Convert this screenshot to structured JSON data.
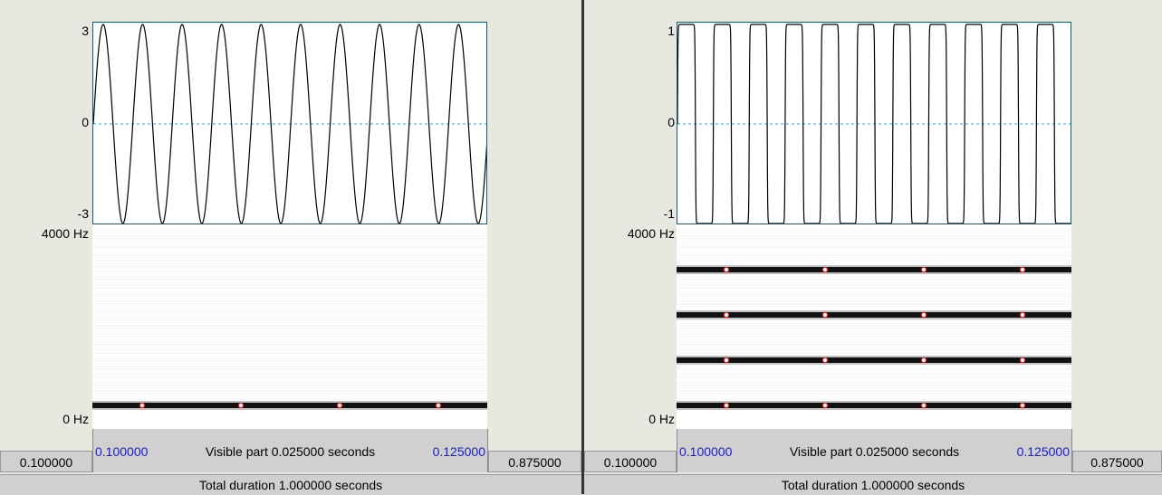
{
  "left_pane": {
    "y_top": "3",
    "y_mid": "0",
    "y_bottom": "-3",
    "freq_top": "4000 Hz",
    "freq_bottom": "0 Hz",
    "window_start": "0.100000",
    "window_end": "0.125000",
    "visible_part": "Visible part 0.025000 seconds",
    "outer_left": "0.100000",
    "outer_right": "0.875000",
    "total_duration": "Total duration 1.000000 seconds",
    "wave_type": "sine",
    "cycles_visible": 10,
    "formant_tracks": 1
  },
  "right_pane": {
    "y_top": "1",
    "y_mid": "0",
    "y_bottom": "-1",
    "freq_top": "4000 Hz",
    "freq_bottom": "0 Hz",
    "window_start": "0.100000",
    "window_end": "0.125000",
    "visible_part": "Visible part 0.025000 seconds",
    "outer_left": "0.100000",
    "outer_right": "0.875000",
    "total_duration": "Total duration 1.000000 seconds",
    "wave_type": "square",
    "cycles_visible": 11,
    "formant_tracks": 4
  },
  "colors": {
    "waveform": "#000000",
    "zero_line": "#3aa0c8",
    "formant_marker": "#e02020",
    "time_label": "#1a1ad6"
  }
}
